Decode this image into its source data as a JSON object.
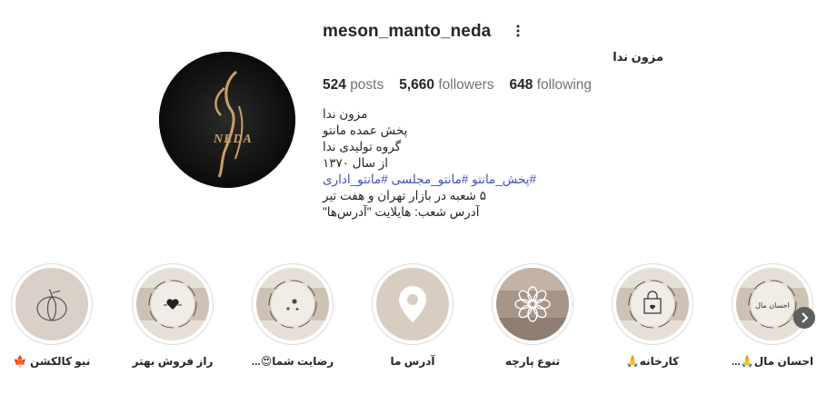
{
  "profile": {
    "username": "meson_manto_neda",
    "full_name": "مزون ندا",
    "avatar_text": "NEDA",
    "stats": {
      "posts_count": "524",
      "posts_label": "posts",
      "followers_count": "5,660",
      "followers_label": "followers",
      "following_count": "648",
      "following_label": "following"
    },
    "bio": {
      "line1": "مزون ندا",
      "line2": "پخش عمده مانتو",
      "line3": "گروه تولیدی ندا",
      "line4": "از سال ۱۳۷۰",
      "hashtags": "#پخش_مانتو #مانتو_مجلسی #مانتو_اداری",
      "line6": "۵ شعبه در بازار تهران و هفت تیر",
      "line7": "آدرس شعب: هایلایت \"آدرس‌ها\""
    }
  },
  "highlights": [
    {
      "label": "احسان مال🙏...",
      "icon": "signature-icon",
      "inner_text": "احسان مال"
    },
    {
      "label": "کارخانه🙏",
      "icon": "shopping-bag-icon"
    },
    {
      "label": "تنوع پارچه",
      "icon": "flower-icon"
    },
    {
      "label": "آدرس ما",
      "icon": "location-pin-icon"
    },
    {
      "label": "رضایت شما😍...",
      "icon": "sparkle-icon"
    },
    {
      "label": "راز فروش بهتر",
      "icon": "heart-icon"
    },
    {
      "label": "نیو کالکشن 🍁",
      "icon": "pumpkin-icon"
    }
  ],
  "colors": {
    "accent_gold": "#c9a066",
    "hashtag_blue": "#4150c8",
    "muted_text": "#737373",
    "highlight_beige": "#d8cdc1"
  }
}
